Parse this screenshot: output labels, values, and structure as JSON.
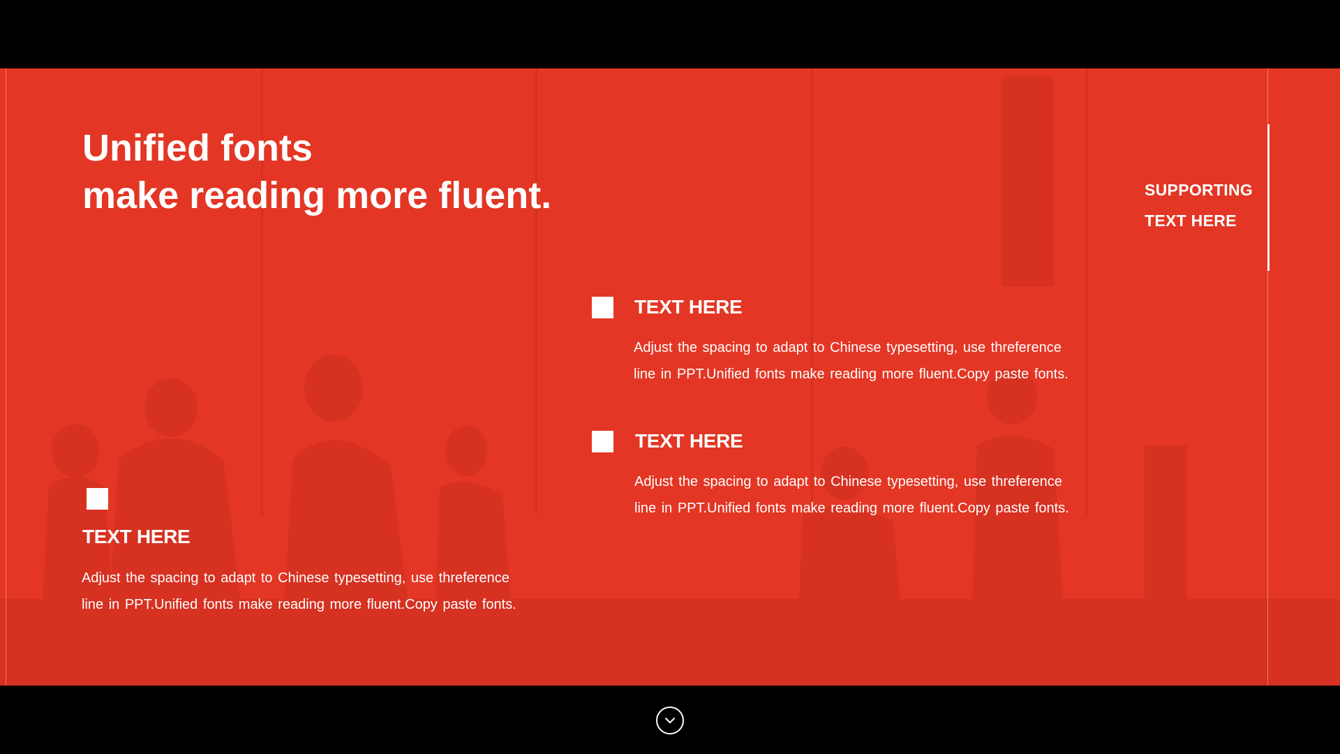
{
  "slide": {
    "title_lines": [
      "Unified fonts",
      "make reading more fluent."
    ],
    "supporting_lines": [
      "SUPPORTING",
      "TEXT HERE"
    ],
    "blocks": [
      {
        "heading": "TEXT HERE",
        "body_lines": [
          "Adjust the spacing to adapt to Chinese typesetting, use threference",
          "line in PPT.Unified fonts make reading more fluent.Copy paste fonts."
        ]
      },
      {
        "heading": "TEXT HERE",
        "body_lines": [
          "Adjust the spacing to adapt to Chinese typesetting, use threference",
          "line in PPT.Unified fonts make reading more fluent.Copy paste fonts."
        ]
      },
      {
        "heading": "TEXT HERE",
        "body_lines": [
          "Adjust the spacing to adapt to Chinese typesetting, use threference",
          "line in PPT.Unified fonts make reading more fluent.Copy paste fonts."
        ]
      }
    ]
  },
  "controls": {
    "next_icon": "chevron-down-circle-icon"
  },
  "colors": {
    "accent": "#e33624",
    "text": "#ffffff",
    "frame": "#000000"
  }
}
